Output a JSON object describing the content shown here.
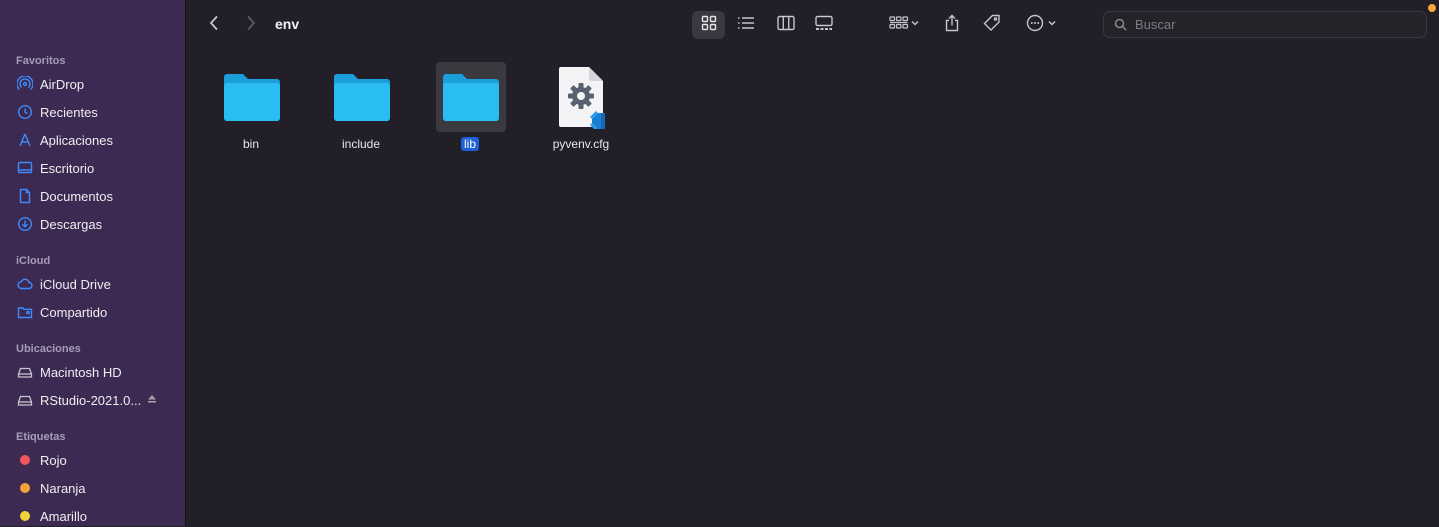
{
  "sidebar": {
    "sections": [
      {
        "title": "Favoritos",
        "items": [
          {
            "label": "AirDrop",
            "icon": "airdrop-icon"
          },
          {
            "label": "Recientes",
            "icon": "clock-icon"
          },
          {
            "label": "Aplicaciones",
            "icon": "applications-icon"
          },
          {
            "label": "Escritorio",
            "icon": "desktop-icon"
          },
          {
            "label": "Documentos",
            "icon": "document-icon"
          },
          {
            "label": "Descargas",
            "icon": "download-icon"
          }
        ]
      },
      {
        "title": "iCloud",
        "items": [
          {
            "label": "iCloud Drive",
            "icon": "cloud-icon"
          },
          {
            "label": "Compartido",
            "icon": "shared-folder-icon"
          }
        ]
      },
      {
        "title": "Ubicaciones",
        "items": [
          {
            "label": "Macintosh HD",
            "icon": "disk-icon"
          },
          {
            "label": "RStudio-2021.0...",
            "icon": "disk-icon"
          }
        ]
      },
      {
        "title": "Etiquetas",
        "items": [
          {
            "label": "Rojo",
            "color": "#f0575a"
          },
          {
            "label": "Naranja",
            "color": "#f5a13a"
          },
          {
            "label": "Amarillo",
            "color": "#f2d23c"
          }
        ]
      }
    ]
  },
  "toolbar": {
    "title": "env",
    "search_placeholder": "Buscar"
  },
  "files": [
    {
      "name": "bin",
      "kind": "folder",
      "selected": false
    },
    {
      "name": "include",
      "kind": "folder",
      "selected": false
    },
    {
      "name": "lib",
      "kind": "folder",
      "selected": true
    },
    {
      "name": "pyvenv.cfg",
      "kind": "config-file",
      "selected": false
    }
  ],
  "colors": {
    "accent": "#1f5fd6",
    "folder": "#1fb6f2",
    "sidebar_icon": "#3d8bfd"
  }
}
